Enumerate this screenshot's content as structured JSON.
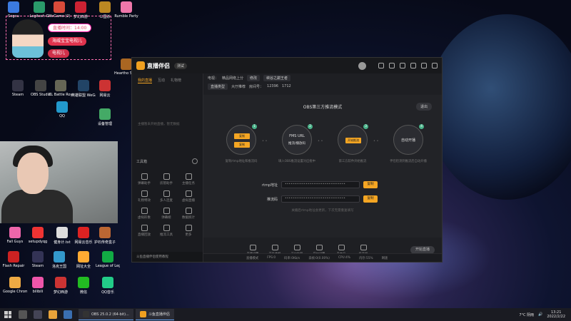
{
  "desktop": {
    "icons": [
      {
        "label": "Sogou",
        "color": "#3b7ae0"
      },
      {
        "label": "Logitech G",
        "color": "#2a9a6a"
      },
      {
        "label": "WeGame (2)",
        "color": "#d84a3a"
      },
      {
        "label": "梦幻西游",
        "color": "#c23"
      },
      {
        "label": "三国杀",
        "color": "#b82"
      },
      {
        "label": "Rumble Party",
        "color": "#e7a"
      },
      {
        "label": "Heartho Screen",
        "color": "#a62"
      },
      {
        "label": "Steam",
        "color": "#334"
      },
      {
        "label": "OBS Studio",
        "color": "#444"
      },
      {
        "label": "ZL Battle Royale",
        "color": "#665"
      },
      {
        "label": "英雄联盟 WeGame",
        "color": "#246"
      },
      {
        "label": "网易云",
        "color": "#c33"
      },
      {
        "label": "QQ",
        "color": "#29c"
      },
      {
        "label": "设备管理",
        "color": "#4a6"
      },
      {
        "label": "Fall Guys",
        "color": "#e6a"
      },
      {
        "label": "setupdyqg",
        "color": "#e33"
      },
      {
        "label": "健身计.txt",
        "color": "#ddd"
      },
      {
        "label": "网易云音乐",
        "color": "#d22"
      },
      {
        "label": "护石传奇盒子",
        "color": "#b63"
      },
      {
        "label": "Flash Repair",
        "color": "#c22"
      },
      {
        "label": "Steam",
        "color": "#335"
      },
      {
        "label": "洛克王国",
        "color": "#39c"
      },
      {
        "label": "网址大全",
        "color": "#fa3"
      },
      {
        "label": "League of Legends",
        "color": "#1a4"
      },
      {
        "label": "Google Chrome",
        "color": "#ea4"
      },
      {
        "label": "bilibili",
        "color": "#e5a"
      },
      {
        "label": "梦幻西游",
        "color": "#c33"
      },
      {
        "label": "微信",
        "color": "#2b2"
      },
      {
        "label": "QQ音乐",
        "color": "#2c8"
      }
    ]
  },
  "overlay": {
    "timer_label": "直播时间：14:00",
    "badge_1": "海威宝宝电视儿",
    "badge_2": "电视儿"
  },
  "app": {
    "name": "直播伴侣",
    "version": "测试",
    "sidebar": {
      "tabs": [
        "我的直播",
        "互动",
        "礼物榜"
      ],
      "empty_text": "主播暂未开始直播，暂无数据",
      "tools_title": "工具箱",
      "tools": [
        {
          "label": "弹幕助手"
        },
        {
          "label": "房管助手"
        },
        {
          "label": "主播任务"
        },
        {
          "label": "礼物特效"
        },
        {
          "label": "多人连麦"
        },
        {
          "label": "虚拟直播"
        },
        {
          "label": "虚拟形象"
        },
        {
          "label": "弹幕姬"
        },
        {
          "label": "数据统计"
        },
        {
          "label": "直播回放"
        },
        {
          "label": "推流工具"
        },
        {
          "label": "更多"
        }
      ],
      "footer": "斗鱼直播伴侣使用教程"
    },
    "info": {
      "category_label": "电视：",
      "category_value": "精品网络上分",
      "chip_change": "修改",
      "room_title": "峡谷之巅王者",
      "room_id_label": "房间号：",
      "room_id_value": "12396",
      "fans": "1712",
      "stream_tag": "直播类型",
      "stream_value": "大厅推荐"
    },
    "obs": {
      "title": "OBS第三方推流模式",
      "exit": "退出",
      "steps": [
        {
          "num": "1",
          "tag_a": "复制",
          "tag_b": "复制",
          "caption": "复制rtmp地址和推流码"
        },
        {
          "num": "2",
          "name": "FMS URL",
          "sub": "推流/播放码",
          "caption": "填入OBS推流设置对应框中"
        },
        {
          "num": "3",
          "tag_a": "开始推流",
          "caption": "第三方软件开始推流"
        },
        {
          "num": "4",
          "name": "自动开播",
          "caption": "伴侣检测到推流后自动开播"
        }
      ],
      "rtmp_label": "rtmp地址",
      "rtmp_value": "••••••••••••••••••••••••••••••••",
      "key_label": "推流码",
      "key_value": "••••••••••••••••••••••••••••••••",
      "copy": "复制",
      "hint": "关播后rtmp地址会更新，下次无需重复填写"
    },
    "bottombar": [
      "直播设置",
      "高级美颜",
      "开启贴图",
      "窗口设置",
      "麦克风",
      "扬声器"
    ],
    "start_button": "开始直播",
    "status": [
      "直播模式",
      "FPS:0",
      "码率:0Kb/s",
      "丢帧:0(0.00%)",
      "CPU:4%",
      "内存:55%",
      "网速"
    ]
  },
  "taskbar": {
    "tasks": [
      "OBS 25.0.2 (64-bit)...",
      "斗鱼直播伴侣"
    ],
    "weather": "7°C 阴雨",
    "time": "13:21",
    "date": "2022/2/22"
  }
}
